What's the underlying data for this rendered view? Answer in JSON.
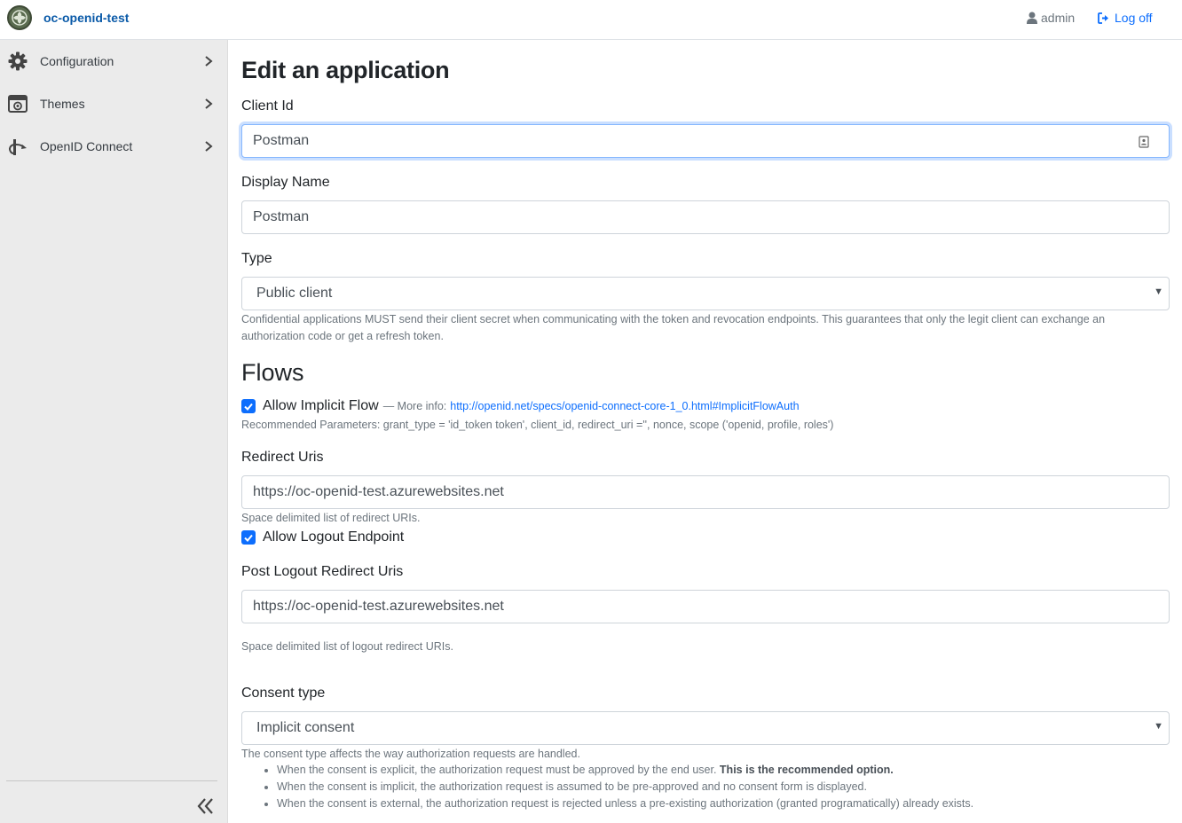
{
  "header": {
    "app_name": "oc-openid-test",
    "user_label": "admin",
    "logoff_label": "Log off"
  },
  "sidebar": {
    "items": [
      {
        "label": "Configuration",
        "icon": "gear-icon"
      },
      {
        "label": "Themes",
        "icon": "themes-icon"
      },
      {
        "label": "OpenID Connect",
        "icon": "openid-icon"
      }
    ]
  },
  "page": {
    "title": "Edit an application",
    "client_id": {
      "label": "Client Id",
      "value": "Postman"
    },
    "display_name": {
      "label": "Display Name",
      "value": "Postman"
    },
    "type": {
      "label": "Type",
      "selected": "Public client",
      "help": "Confidential applications MUST send their client secret when communicating with the token and revocation endpoints. This guarantees that only the legit client can exchange an",
      "help2": "authorization code or get a refresh token."
    },
    "flows": {
      "title": "Flows",
      "implicit": {
        "label": "Allow Implicit Flow",
        "checked": true,
        "more_info": "— More info:",
        "link": "http://openid.net/specs/openid-connect-core-1_0.html#ImplicitFlowAuth",
        "recommended": "Recommended Parameters: grant_type = 'id_token token', client_id, redirect_uri ='', nonce, scope ('openid, profile, roles')"
      }
    },
    "redirect_uris": {
      "label": "Redirect Uris",
      "value": "https://oc-openid-test.azurewebsites.net",
      "help": "Space delimited list of redirect URIs."
    },
    "logout": {
      "label": "Allow Logout Endpoint",
      "checked": true
    },
    "post_logout": {
      "label": "Post Logout Redirect Uris",
      "value": "https://oc-openid-test.azurewebsites.net",
      "help": "Space delimited list of logout redirect URIs."
    },
    "consent": {
      "label": "Consent type",
      "selected": "Implicit consent",
      "help": "The consent type affects the way authorization requests are handled.",
      "bullet1": "When the consent is explicit, the authorization request must be approved by the end user.",
      "bullet1_bold": "This is the recommended option.",
      "bullet2": "When the consent is implicit, the authorization request is assumed to be pre-approved and no consent form is displayed.",
      "bullet3": "When the consent is external, the authorization request is rejected unless a pre-existing authorization (granted programatically) already exists."
    }
  },
  "colors": {
    "accent": "#0d6efd",
    "brand_text": "#0a5aa8",
    "sidebar_bg": "#ebebeb"
  }
}
